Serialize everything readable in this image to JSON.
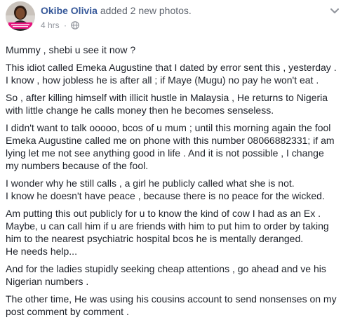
{
  "header": {
    "author_name": "Okibe Olivia",
    "action": "added 2 new photos.",
    "time": "4 hrs",
    "separator": "·",
    "privacy_icon": "globe-icon",
    "menu_icon": "chevron-down-icon"
  },
  "colors": {
    "link": "#365899",
    "meta": "#90949c",
    "text": "#1d2129",
    "avatar_accent": "#e5127d"
  },
  "post": {
    "paragraphs": [
      [
        "Mummy , shebi u see it now ?"
      ],
      [
        "This idiot called Emeka Augustine that I dated by error sent this , yesterday .",
        "I know , how jobless he is after all ; if Maye (Mugu) no pay he won't eat ."
      ],
      [
        "So , after killing himself with illicit hustle in Malaysia , He returns to Nigeria",
        "with little change he calls money then he becomes senseless."
      ],
      [
        "I didn't want to talk ooooo, bcos of u mum ; until this morning again the fool",
        "Emeka Augustine called me on phone with this number 08066882331; if am",
        "lying let me not see anything good in life . And it is not possible , I change",
        "my numbers because of the fool."
      ],
      [
        "I wonder why he still calls , a girl he publicly called what she is not.",
        "I know he doesn't have peace , because there is no peace for the wicked."
      ],
      [
        "Am putting this out publicly for u to know the kind of cow I had as an Ex .",
        "Maybe, u can call him if u are friends with him to put him to order by taking",
        "him to the nearest psychiatric hospital bcos he is mentally deranged.",
        "He needs help..."
      ],
      [
        "And for the ladies stupidly seeking cheap attentions , go ahead and ve his",
        "Nigerian numbers ."
      ],
      [
        "The other time, He was using his cousins account to send nonsenses on my",
        "post comment by comment ."
      ]
    ]
  }
}
